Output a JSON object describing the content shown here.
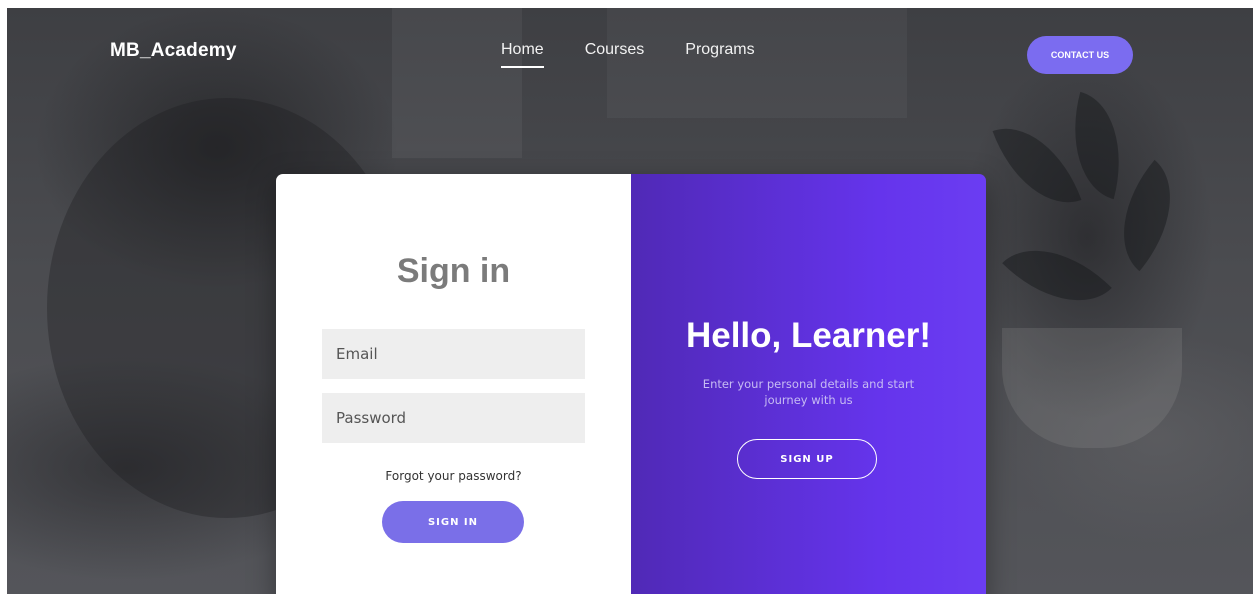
{
  "brand": "MB_Academy",
  "nav": {
    "links": [
      "Home",
      "Courses",
      "Programs"
    ],
    "active": "Home",
    "contact_label": "CONTACT US"
  },
  "signin": {
    "title": "Sign in",
    "email_placeholder": "Email",
    "password_placeholder": "Password",
    "forgot": "Forgot your password?",
    "button": "SIGN IN"
  },
  "welcome": {
    "title": "Hello, Learner!",
    "subtitle": "Enter your personal details and start journey with us",
    "button": "SIGN UP"
  },
  "colors": {
    "accent": "#7b6cf0",
    "panel_start": "#5029b6",
    "panel_end": "#6b3df2"
  }
}
